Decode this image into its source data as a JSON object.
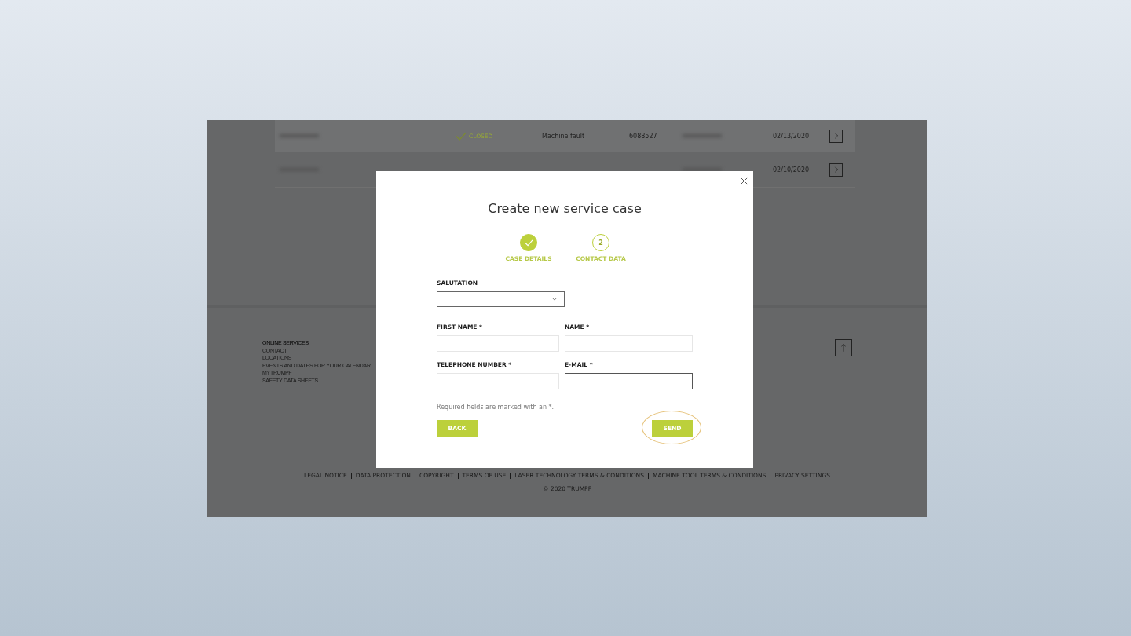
{
  "background_table": {
    "rows": [
      {
        "status": "CLOSED",
        "category": "Machine fault",
        "number": "6088527",
        "date": "02/13/2020",
        "highlighted": true
      },
      {
        "date": "02/10/2020",
        "highlighted": false
      }
    ]
  },
  "footer": {
    "links": [
      "ONLINE SERVICES",
      "CONTACT",
      "LOCATIONS",
      "EVENTS AND DATES FOR YOUR CALENDAR",
      "MYTRUMPF",
      "SAFETY DATA SHEETS"
    ],
    "legal_links": [
      "LEGAL NOTICE",
      "DATA PROTECTION",
      "COPYRIGHT",
      "TERMS OF USE",
      "LASER TECHNOLOGY TERMS & CONDITIONS",
      "MACHINE TOOL TERMS & CONDITIONS",
      "PRIVACY SETTINGS"
    ],
    "copyright": "© 2020 TRUMPF"
  },
  "dialog": {
    "title": "Create new service case",
    "steps": [
      {
        "label": "CASE DETAILS",
        "done": true
      },
      {
        "label": "CONTACT DATA",
        "number": "2",
        "done": false
      }
    ],
    "salutation": {
      "label": "SALUTATION"
    },
    "fields": [
      {
        "label": "FIRST NAME *",
        "focused": false
      },
      {
        "label": "NAME *",
        "focused": false
      },
      {
        "label": "TELEPHONE NUMBER *",
        "focused": false
      },
      {
        "label": "E-MAIL *",
        "focused": true
      }
    ],
    "note": "Required fields are marked with an *.",
    "buttons": [
      {
        "label": "BACK",
        "highlighted": false
      },
      {
        "label": "SEND",
        "highlighted": true
      }
    ]
  }
}
